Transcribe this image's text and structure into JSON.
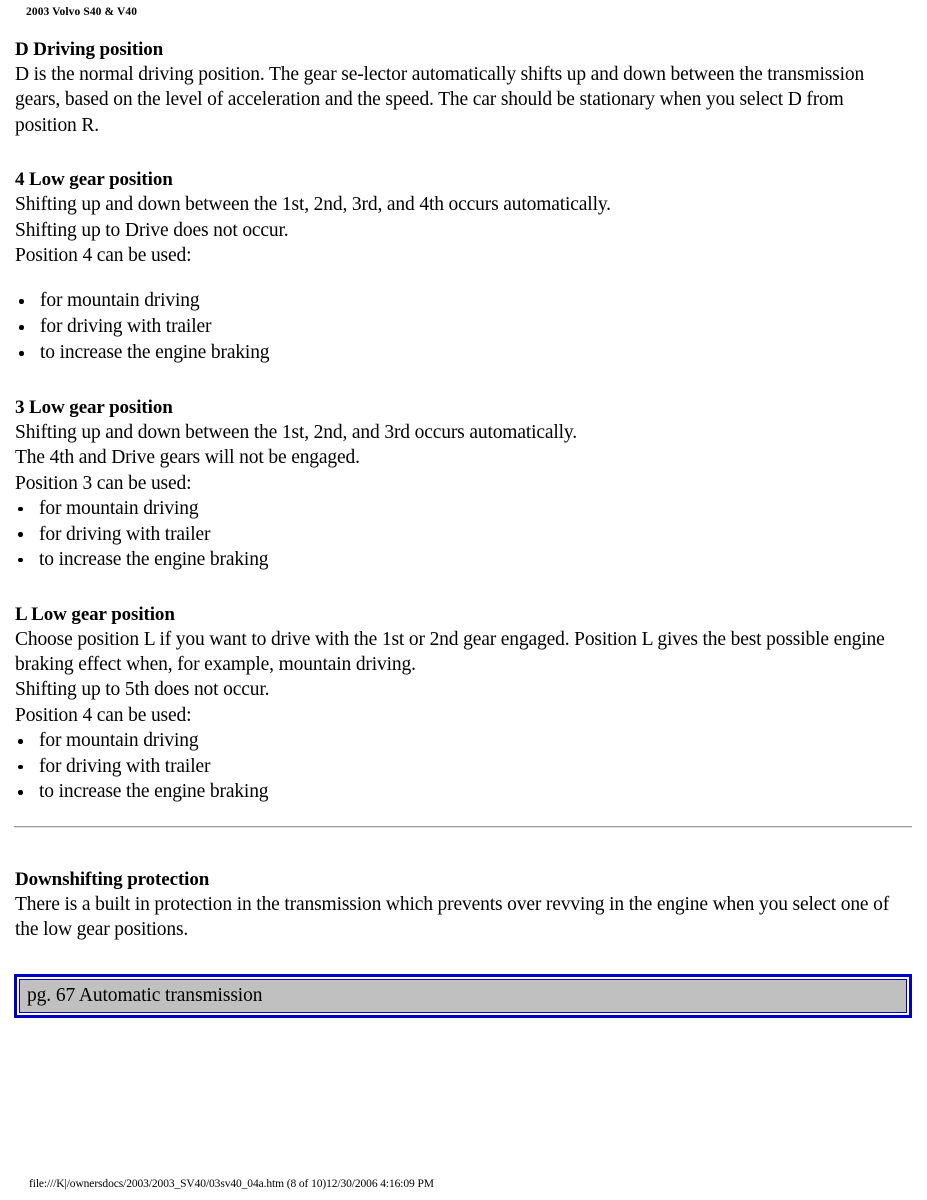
{
  "header": {
    "running_title": "2003 Volvo S40 & V40"
  },
  "sections": [
    {
      "heading": "D Driving position",
      "paragraph": "D is the normal driving position. The gear se-lector automatically shifts up and down between the transmission gears, based on the level of acceleration and the speed. The car should be stationary when you select D from position R."
    },
    {
      "heading": "4 Low gear position",
      "line1": "Shifting up and down between the 1st, 2nd, 3rd, and 4th occurs automatically.",
      "line2": "Shifting up to Drive does not occur.",
      "line3": "Position 4 can be used:",
      "bullets": [
        "for mountain driving",
        "for driving with trailer",
        "to increase the engine braking"
      ]
    },
    {
      "heading": "3 Low gear position",
      "line1": "Shifting up and down between the 1st, 2nd, and 3rd occurs automatically.",
      "line2": "The 4th and Drive gears will not be engaged.",
      "line3": "Position 3 can be used:",
      "bullets": [
        "for mountain driving",
        "for driving with trailer",
        "to increase the engine braking"
      ]
    },
    {
      "heading": "L Low gear position",
      "line1": "Choose position L if you want to drive with the 1st or 2nd gear engaged. Position L gives the best possible engine braking effect when, for example, mountain driving.",
      "line2": "Shifting up to 5th does not occur.",
      "line3": "Position 4 can be used:",
      "bullets": [
        "for mountain driving",
        "for driving with trailer",
        "to increase the engine braking"
      ]
    }
  ],
  "downshifting": {
    "heading": "Downshifting protection",
    "paragraph": "There is a built in protection in the transmission which prevents over revving in the engine when you select one of the low gear positions."
  },
  "nav_link": {
    "label": "pg. 67 Automatic transmission",
    "border_color": "#0000cc",
    "background_color": "#c0c0c0"
  },
  "footer": {
    "text": "file:///K|/ownersdocs/2003/2003_SV40/03sv40_04a.htm (8 of 10)12/30/2006 4:16:09 PM"
  }
}
